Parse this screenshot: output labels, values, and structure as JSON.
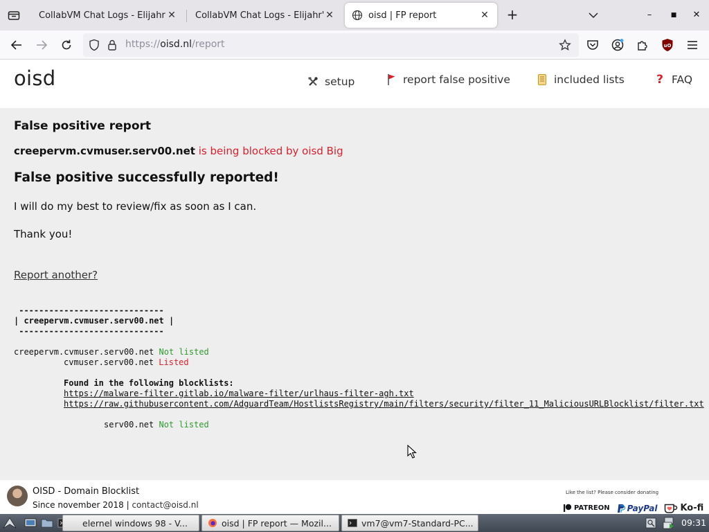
{
  "browser": {
    "tabs": [
      {
        "title": "CollabVM Chat Logs - Elijahr's"
      },
      {
        "title": "CollabVM Chat Logs - Elijahr's"
      },
      {
        "title": "oisd | FP report"
      }
    ],
    "url_scheme": "https://",
    "url_host": "oisd.nl",
    "url_path": "/report"
  },
  "site": {
    "logo": "oisd",
    "menu": [
      {
        "label": "setup",
        "icon": "tools-icon"
      },
      {
        "label": "report false positive",
        "icon": "red-flag-icon"
      },
      {
        "label": "included lists",
        "icon": "scroll-icon"
      },
      {
        "label": "FAQ",
        "icon": "question-mark-icon"
      }
    ]
  },
  "report": {
    "heading": "False positive report",
    "domain": "creepervm.cvmuser.serv00.net",
    "status": "is being blocked by oisd Big",
    "success_heading": "False positive successfully reported!",
    "message": "I will do my best to review/fix as soon as I can.",
    "thanks": "Thank you!",
    "report_another": "Report another?"
  },
  "lookup": {
    "border": " -----------------------------",
    "header": "| creepervm.cvmuser.serv00.net |",
    "rows": [
      {
        "domain": "creepervm.cvmuser.serv00.net",
        "status": "Not listed",
        "color": "#2e9b2e"
      },
      {
        "domain": "cvmuser.serv00.net",
        "status": "Listed",
        "color": "#d9212c"
      },
      {
        "domain": "serv00.net",
        "status": "Not listed",
        "color": "#2e9b2e"
      }
    ],
    "found_label": "Found in the following blocklists:",
    "blocklists": [
      "https://malware-filter.gitlab.io/malware-filter/urlhaus-filter-agh.txt",
      "https://raw.githubusercontent.com/AdguardTeam/HostlistsRegistry/main/filters/security/filter_11_MaliciousURLBlocklist/filter.txt"
    ]
  },
  "footer": {
    "title": "OISD - Domain Blocklist",
    "since": "Since november 2018 |",
    "contact": "contact@oisd.nl",
    "donate_note": "Like the list? Please consider donating",
    "patreon": "PATREON",
    "paypal": "PayPal",
    "kofi": "Ko-fi"
  },
  "taskbar": {
    "tasks": [
      {
        "label": "elernel windows 98 - V..."
      },
      {
        "label": "oisd | FP report — Mozil..."
      },
      {
        "label": "vm7@vm7-Standard-PC..."
      }
    ],
    "clock": "09:31"
  }
}
